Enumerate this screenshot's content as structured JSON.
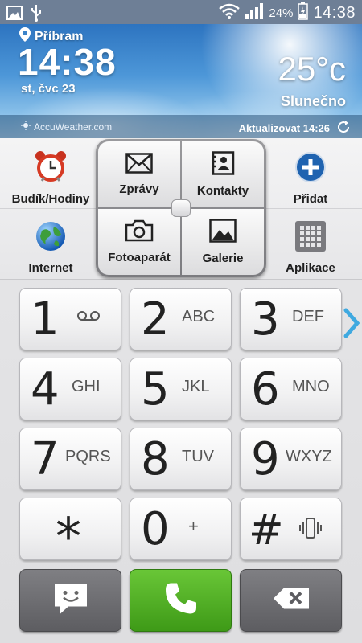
{
  "status_bar": {
    "battery_percent": "24%",
    "time": "14:38",
    "icons": [
      "image-icon",
      "usb-icon",
      "wifi-icon",
      "signal-icon",
      "battery-charging-icon"
    ]
  },
  "weather": {
    "location": "Příbram",
    "clock": "14:38",
    "date": "st, čvc 23",
    "temperature": "25°c",
    "condition": "Slunečno",
    "brand": "AccuWeather.com",
    "update_label": "Aktualizovat 14:26"
  },
  "shortcuts": {
    "alarm": "Budík/Hodiny",
    "messages": "Zprávy",
    "contacts": "Kontakty",
    "add": "Přidat",
    "internet": "Internet",
    "camera": "Fotoaparát",
    "gallery": "Galerie",
    "apps": "Aplikace"
  },
  "keypad": {
    "keys": [
      {
        "num": "1",
        "letters": "",
        "icon": "voicemail-icon"
      },
      {
        "num": "2",
        "letters": "ABC"
      },
      {
        "num": "3",
        "letters": "DEF"
      },
      {
        "num": "4",
        "letters": "GHI"
      },
      {
        "num": "5",
        "letters": "JKL"
      },
      {
        "num": "6",
        "letters": "MNO"
      },
      {
        "num": "7",
        "letters": "PQRS"
      },
      {
        "num": "8",
        "letters": "TUV"
      },
      {
        "num": "9",
        "letters": "WXYZ"
      },
      {
        "num": "*",
        "letters": ""
      },
      {
        "num": "0",
        "letters": "+"
      },
      {
        "num": "#",
        "letters": "",
        "icon": "vibrate-icon"
      }
    ],
    "bottom": [
      "message-icon",
      "call-icon",
      "backspace-icon"
    ]
  },
  "colors": {
    "call_green": "#4caf22",
    "dark_key": "#6b6b6f",
    "accent_blue": "#1f7cc4"
  }
}
